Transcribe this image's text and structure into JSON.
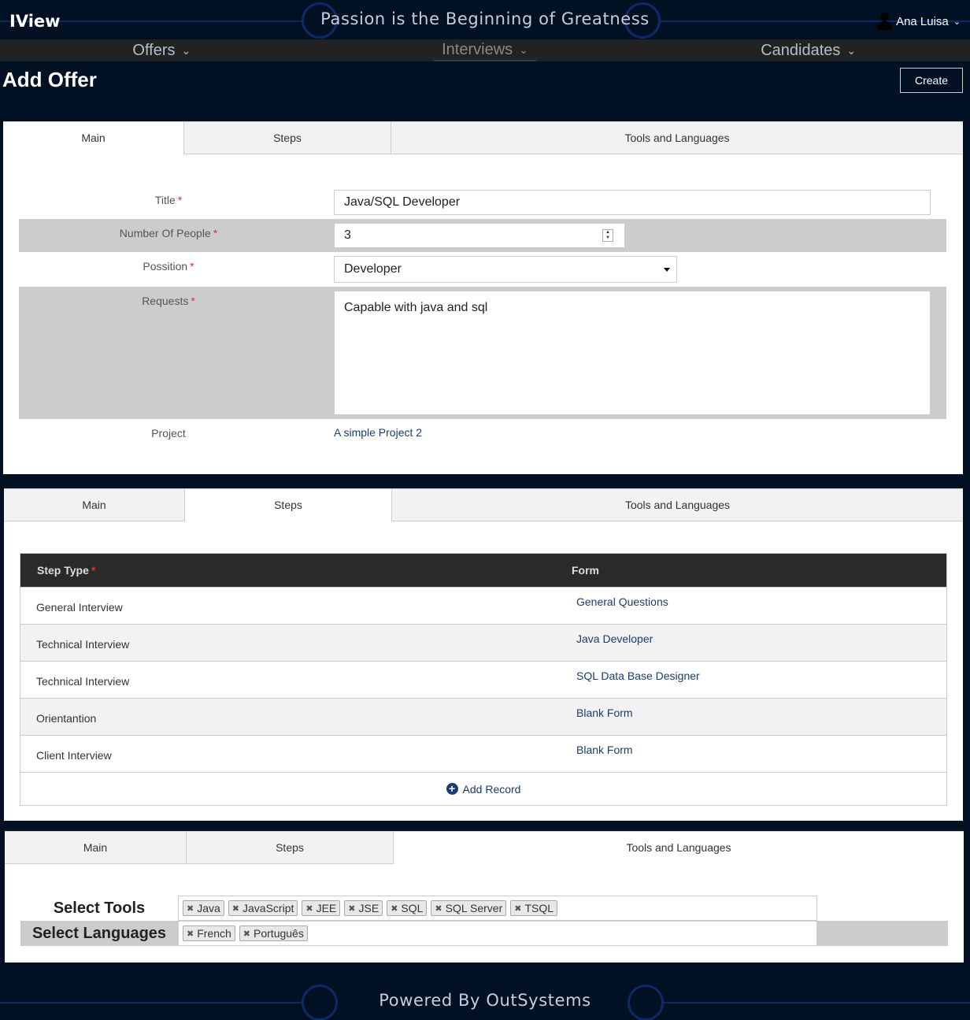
{
  "header": {
    "brand": "IView",
    "slogan": "Passion is the Beginning of Greatness",
    "user_name": "Ana Luisa"
  },
  "menu": [
    {
      "label": "Offers"
    },
    {
      "label": "Interviews"
    },
    {
      "label": "Candidates"
    }
  ],
  "page": {
    "title": "Add Offer",
    "create_label": "Create"
  },
  "tabs": [
    "Main",
    "Steps",
    "Tools and Languages"
  ],
  "main_form": {
    "title_label": "Title",
    "title_value": "Java/SQL Developer",
    "people_label": "Number Of People",
    "people_value": "3",
    "position_label": "Possition",
    "position_value": "Developer",
    "requests_label": "Requests",
    "requests_value": "Capable with java and sql",
    "project_label": "Project",
    "project_value": "A simple Project 2"
  },
  "steps_table": {
    "col_step_type": "Step Type",
    "col_form": "Form",
    "rows": [
      {
        "step_type": "General Interview",
        "form": "General Questions"
      },
      {
        "step_type": "Technical Interview",
        "form": "Java Developer"
      },
      {
        "step_type": "Technical Interview",
        "form": "SQL Data Base Designer"
      },
      {
        "step_type": "Orientantion",
        "form": "Blank Form"
      },
      {
        "step_type": "Client Interview",
        "form": "Blank Form"
      }
    ],
    "add_record_label": "Add Record"
  },
  "tools_languages": {
    "tools_label": "Select Tools",
    "tools": [
      "Java",
      "JavaScript",
      "JEE",
      "JSE",
      "SQL",
      "SQL Server",
      "TSQL"
    ],
    "languages_label": "Select Languages",
    "languages": [
      "French",
      "Português"
    ]
  },
  "footer": {
    "text": "Powered By OutSystems"
  },
  "colors": {
    "background": "#021024",
    "menubar": "#222222",
    "circuit": "#0c2a66",
    "link": "#1a3c6e",
    "required": "#dd3333"
  }
}
